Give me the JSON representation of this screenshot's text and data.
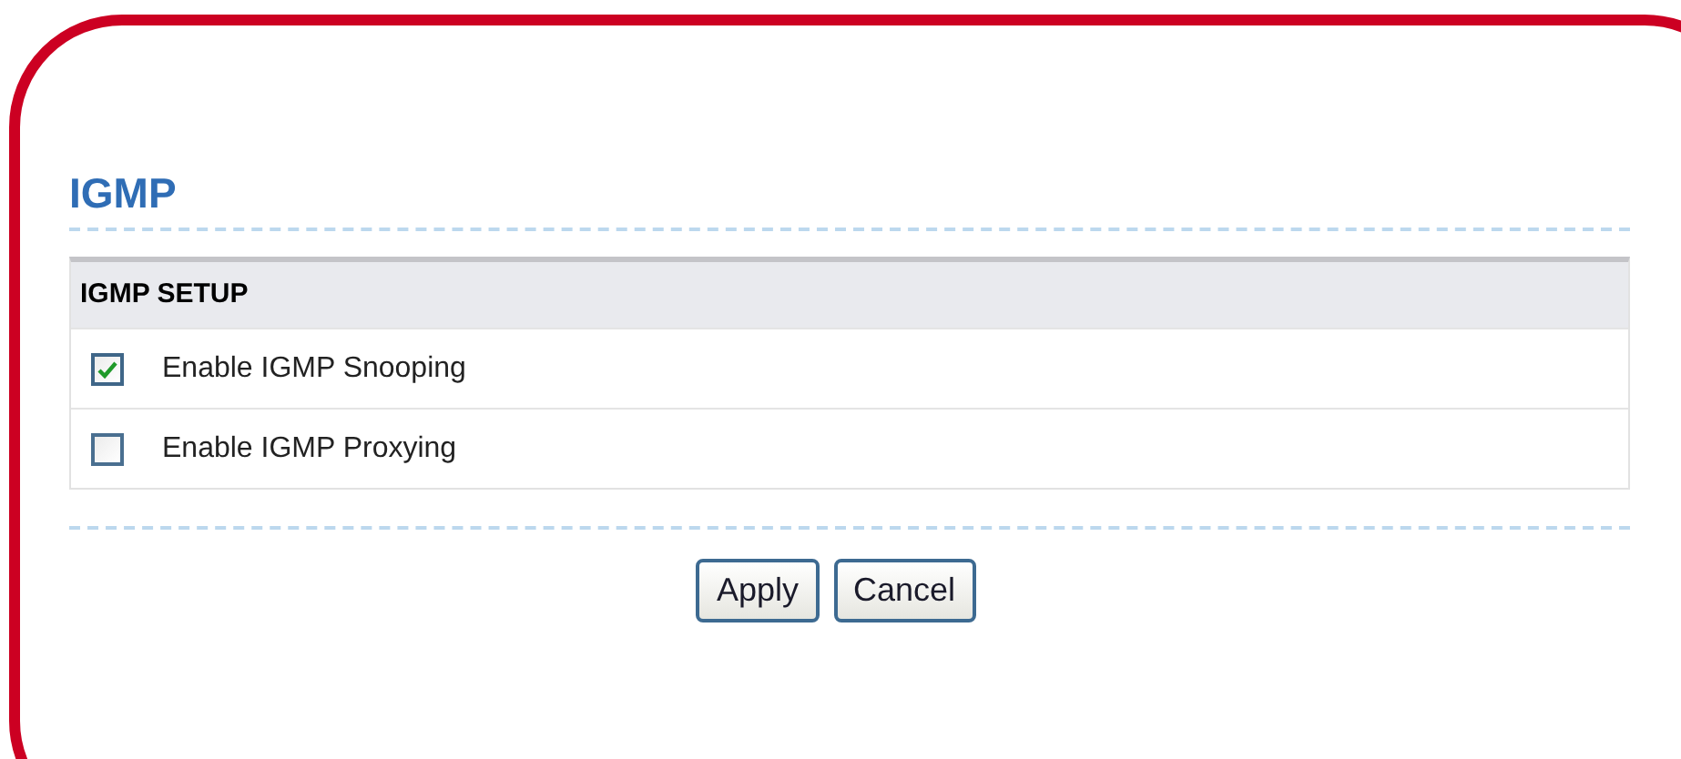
{
  "title": "IGMP",
  "section": {
    "heading": "IGMP SETUP",
    "options": [
      {
        "label": "Enable IGMP Snooping",
        "checked": true
      },
      {
        "label": "Enable IGMP Proxying",
        "checked": false
      }
    ]
  },
  "buttons": [
    "Apply",
    "Cancel"
  ]
}
